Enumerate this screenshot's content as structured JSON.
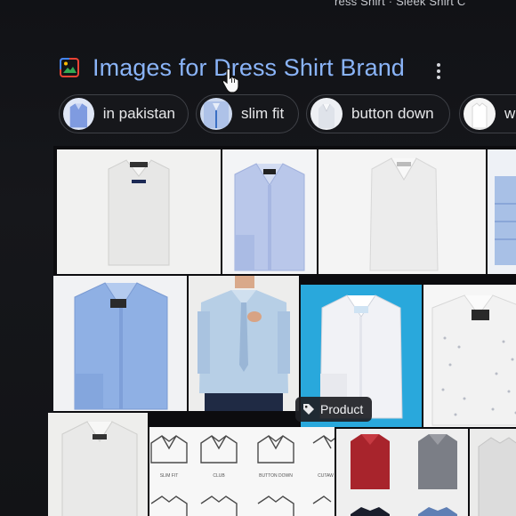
{
  "top_bar": {
    "fragment_left": "ress Shirt",
    "separator": "·",
    "fragment_right": "Sleek Shirt C"
  },
  "section": {
    "icon": "images-icon",
    "title": "Images for Dress Shirt Brand",
    "more_icon": "more-vert-icon"
  },
  "chips": [
    {
      "label": "in pakistan",
      "thumb_color": "#8fa8e6"
    },
    {
      "label": "slim fit",
      "thumb_color": "#b8c9e8"
    },
    {
      "label": "button down",
      "thumb_color": "#eef0f4"
    },
    {
      "label": "w",
      "thumb_color": "#f3f3f3"
    }
  ],
  "results": {
    "product_badge": "Product",
    "product_icon": "tag-icon"
  },
  "icon_grid_labels": [
    "SLIM FIT",
    "CLUB",
    "BUTTON DOWN",
    "CUTAW"
  ],
  "colors": {
    "accent": "#8ab4f8",
    "background": "#121316",
    "product_bg": "#29a8dc"
  }
}
